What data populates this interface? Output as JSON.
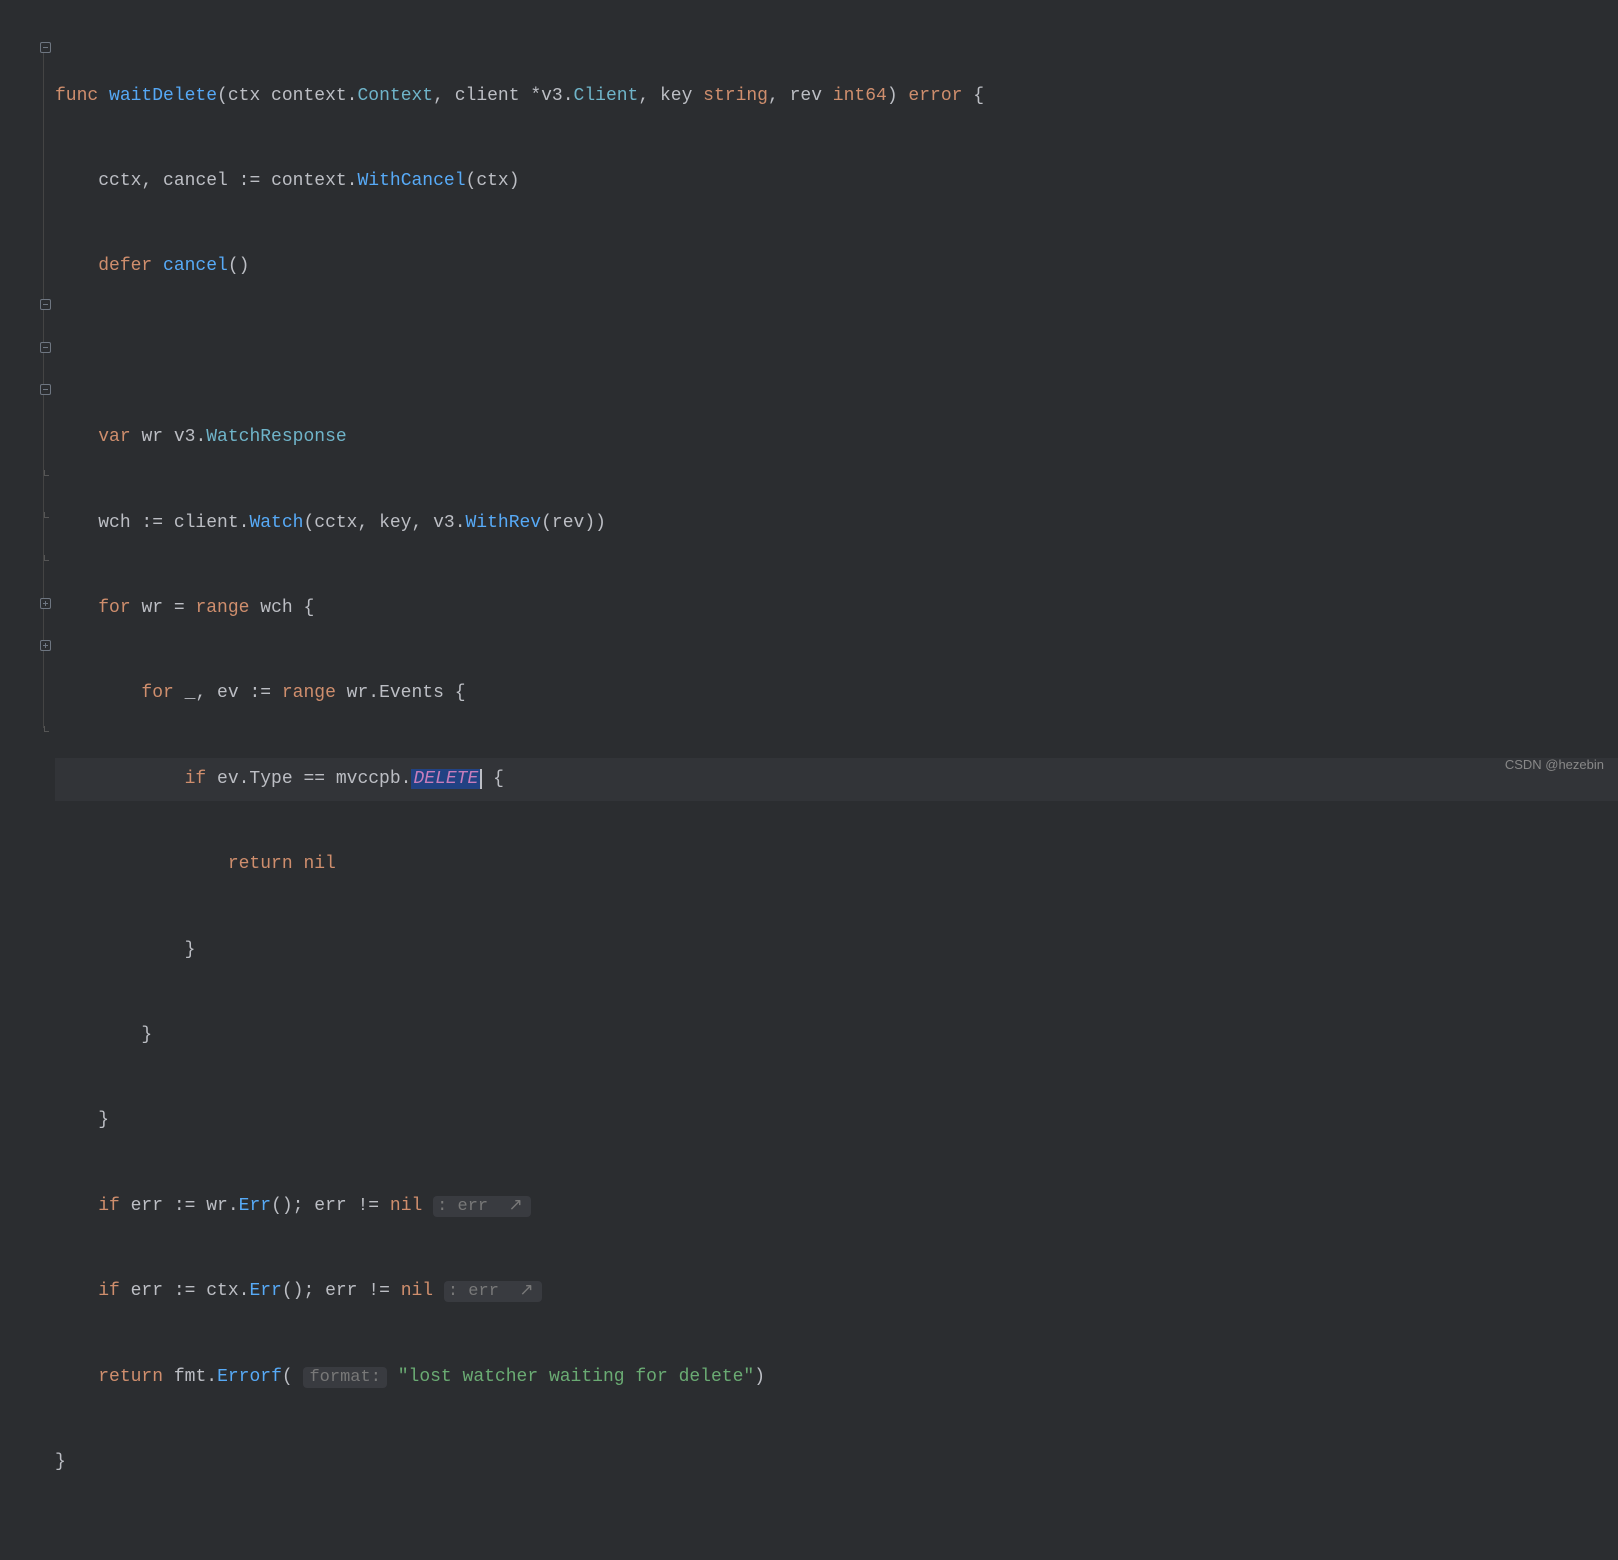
{
  "code": {
    "l1": {
      "func": "func ",
      "name": "waitDelete",
      "p0": "(ctx context.",
      "t0": "Context",
      "p1": ", client *v3.",
      "t1": "Client",
      "p2": ", key ",
      "t2": "string",
      "p3": ", rev ",
      "t3": "int64",
      "p4": ") ",
      "t4": "error",
      "p5": " {"
    },
    "l2": {
      "indent": "    ",
      "v0": "cctx",
      "c0": ", ",
      "v1": "cancel",
      "c1": " := context.",
      "fn": "WithCancel",
      "args": "(ctx)"
    },
    "l3": {
      "indent": "    ",
      "kw": "defer ",
      "fn": "cancel",
      "args": "()"
    },
    "l4": "",
    "l5": {
      "indent": "    ",
      "kw": "var ",
      "v": "wr v3.",
      "t": "WatchResponse"
    },
    "l6": {
      "indent": "    ",
      "v": "wch := client.",
      "fn": "Watch",
      "a0": "(cctx, key, v3.",
      "fn2": "WithRev",
      "a1": "(rev))"
    },
    "l7": {
      "indent": "    ",
      "kw": "for ",
      "v": "wr = ",
      "kw2": "range ",
      "v2": "wch {"
    },
    "l8": {
      "indent": "        ",
      "kw": "for ",
      "v": "_, ev := ",
      "kw2": "range ",
      "v2": "wr.Events {"
    },
    "l9": {
      "indent": "            ",
      "kw": "if ",
      "v": "ev.Type == mvccpb.",
      "const": "DELETE",
      "v2": " {"
    },
    "l10": {
      "indent": "                ",
      "kw": "return ",
      "v": "nil"
    },
    "l11": {
      "indent": "            ",
      "brace": "}"
    },
    "l12": {
      "indent": "        ",
      "brace": "}"
    },
    "l13": {
      "indent": "    ",
      "brace": "}"
    },
    "l14": {
      "indent": "    ",
      "kw": "if ",
      "v": "err := wr.",
      "fn": "Err",
      "a": "(); err != ",
      "nil": "nil ",
      "hint": ": err "
    },
    "l15": {
      "indent": "    ",
      "kw": "if ",
      "v": "err := ctx.",
      "fn": "Err",
      "a": "(); err != ",
      "nil": "nil ",
      "hint": ": err "
    },
    "l16": {
      "indent": "    ",
      "kw": "return ",
      "v": "fmt.",
      "fn": "Errorf",
      "a0": "( ",
      "hint": "format:",
      "a1": " ",
      "str": "\"lost watcher waiting for delete\"",
      "a2": ")"
    },
    "l17": {
      "brace": "}"
    }
  },
  "watermark": "CSDN @hezebin"
}
